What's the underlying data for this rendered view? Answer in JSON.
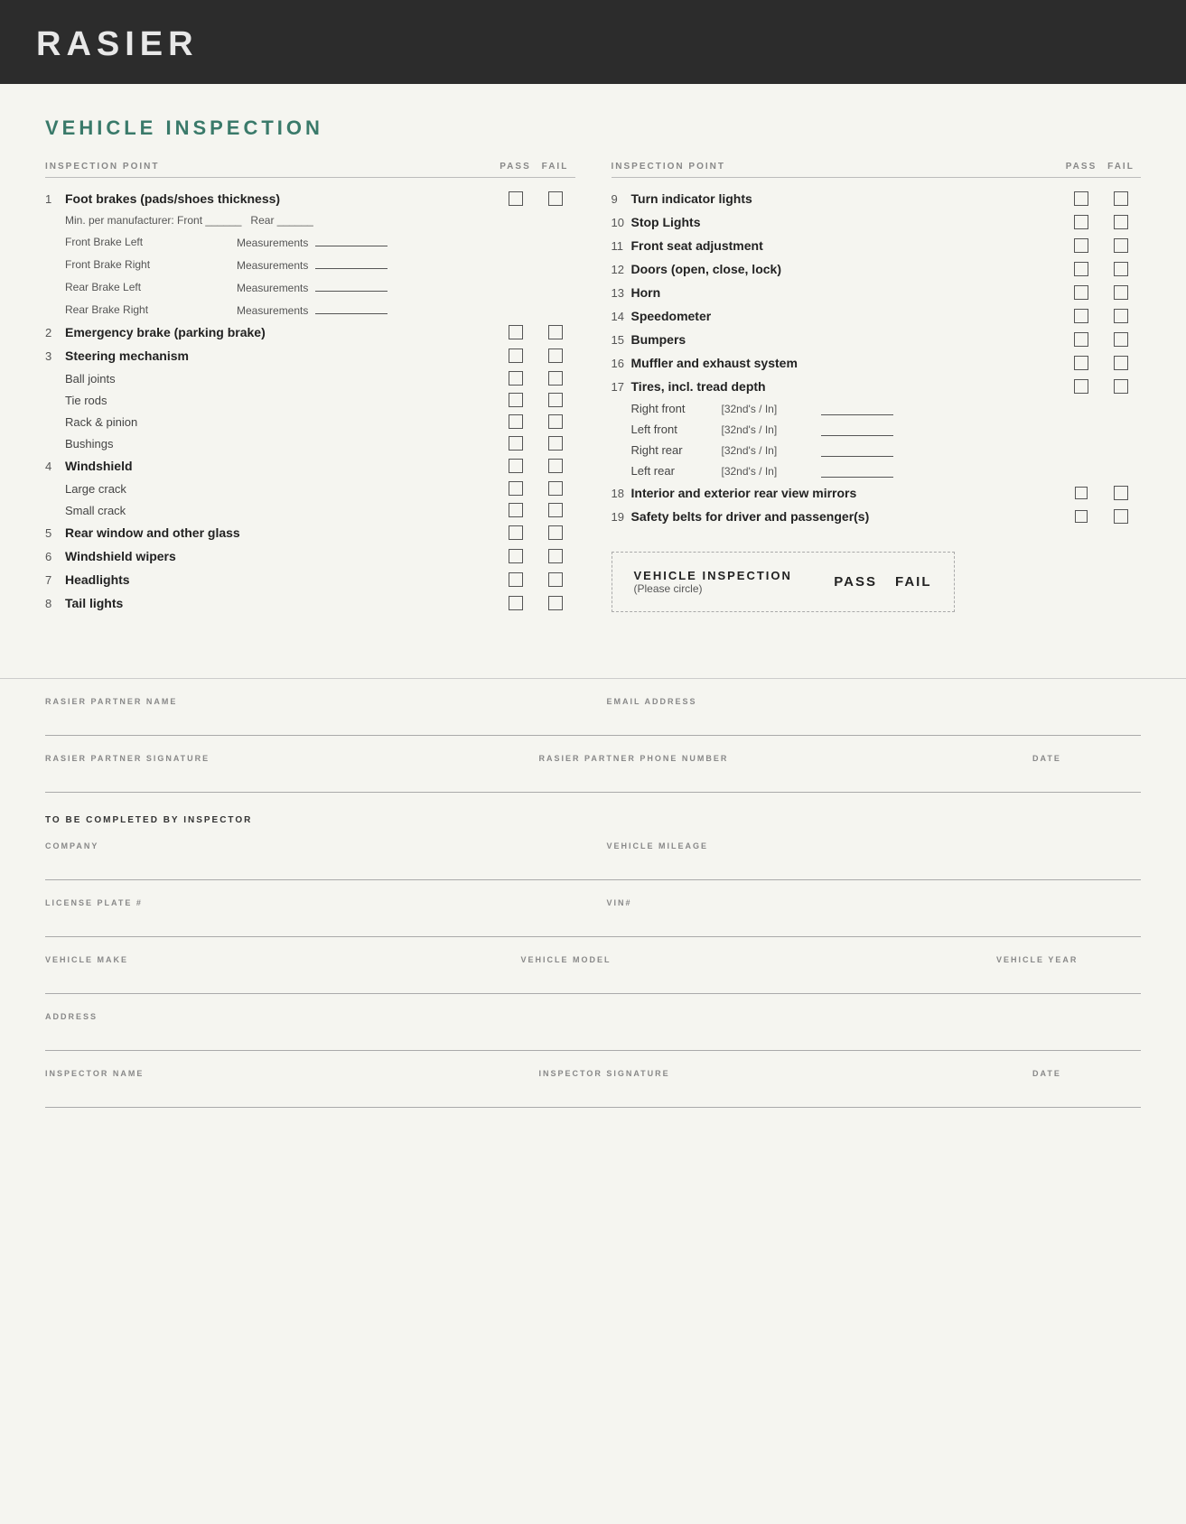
{
  "header": {
    "title": "RASIER"
  },
  "page": {
    "section_title": "VEHICLE INSPECTION",
    "col_headers": {
      "inspection_point": "INSPECTION POINT",
      "pass": "PASS",
      "fail": "FAIL"
    }
  },
  "left_items": [
    {
      "num": "1",
      "text": "Foot brakes (pads/shoes thickness)",
      "bold": true,
      "has_pass_fail": true,
      "sub_items": [
        {
          "type": "mfr",
          "text": "Min. per manufacturer:  Front ______   Rear ______"
        },
        {
          "type": "measurement",
          "label": "Front Brake Left",
          "sublabel": "Measurements"
        },
        {
          "type": "measurement",
          "label": "Front Brake Right",
          "sublabel": "Measurements"
        },
        {
          "type": "measurement",
          "label": "Rear Brake Left",
          "sublabel": "Measurements"
        },
        {
          "type": "measurement",
          "label": "Rear Brake Right",
          "sublabel": "Measurements"
        }
      ]
    },
    {
      "num": "2",
      "text": "Emergency brake (parking brake)",
      "bold": true,
      "has_pass_fail": true
    },
    {
      "num": "3",
      "text": "Steering mechanism",
      "bold": true,
      "has_pass_fail": true,
      "sub_items": [
        {
          "type": "checkbox",
          "text": "Ball joints"
        },
        {
          "type": "checkbox",
          "text": "Tie rods"
        },
        {
          "type": "checkbox",
          "text": "Rack & pinion"
        },
        {
          "type": "checkbox",
          "text": "Bushings"
        }
      ]
    },
    {
      "num": "4",
      "text": "Windshield",
      "bold": true,
      "has_pass_fail": true,
      "sub_items": [
        {
          "type": "checkbox",
          "text": "Large crack"
        },
        {
          "type": "checkbox",
          "text": "Small crack"
        }
      ]
    },
    {
      "num": "5",
      "text": "Rear window and other glass",
      "bold": true,
      "has_pass_fail": true
    },
    {
      "num": "6",
      "text": "Windshield wipers",
      "bold": true,
      "has_pass_fail": true
    },
    {
      "num": "7",
      "text": "Headlights",
      "bold": true,
      "has_pass_fail": true
    },
    {
      "num": "8",
      "text": "Tail lights",
      "bold": true,
      "has_pass_fail": true
    }
  ],
  "right_items": [
    {
      "num": "9",
      "text": "Turn indicator lights",
      "bold": true,
      "has_pass_fail": true
    },
    {
      "num": "10",
      "text": "Stop Lights",
      "bold": true,
      "has_pass_fail": true
    },
    {
      "num": "11",
      "text": "Front seat adjustment",
      "bold": true,
      "has_pass_fail": true
    },
    {
      "num": "12",
      "text": "Doors (open, close, lock)",
      "bold": true,
      "has_pass_fail": true
    },
    {
      "num": "13",
      "text": "Horn",
      "bold": true,
      "has_pass_fail": true
    },
    {
      "num": "14",
      "text": "Speedometer",
      "bold": true,
      "has_pass_fail": true
    },
    {
      "num": "15",
      "text": "Bumpers",
      "bold": true,
      "has_pass_fail": true
    },
    {
      "num": "16",
      "text": "Muffler and exhaust system",
      "bold": true,
      "has_pass_fail": true
    },
    {
      "num": "17",
      "text": "Tires, incl. tread depth",
      "bold": true,
      "has_pass_fail": true,
      "tires": [
        {
          "label": "Right front",
          "unit": "[32nd's / In]"
        },
        {
          "label": "Left front",
          "unit": "[32nd's / In]"
        },
        {
          "label": "Right rear",
          "unit": "[32nd's / In]"
        },
        {
          "label": "Left rear",
          "unit": "[32nd's / In]"
        }
      ]
    },
    {
      "num": "18",
      "text": "Interior and exterior rear view mirrors",
      "bold": true,
      "has_pass_fail": true
    },
    {
      "num": "19",
      "text": "Safety belts for driver and passenger(s)",
      "bold": true,
      "has_pass_fail": true
    }
  ],
  "summary_box": {
    "title": "VEHICLE INSPECTION",
    "subtitle": "(Please circle)",
    "pass_label": "PASS",
    "fail_label": "FAIL"
  },
  "form_fields": {
    "partner_name_label": "RASIER PARTNER NAME",
    "email_label": "EMAIL ADDRESS",
    "partner_signature_label": "RASIER PARTNER SIGNATURE",
    "partner_phone_label": "RASIER PARTNER PHONE NUMBER",
    "date_label": "DATE",
    "inspector_section_label": "TO BE COMPLETED BY INSPECTOR",
    "company_label": "COMPANY",
    "vehicle_mileage_label": "VEHICLE MILEAGE",
    "license_plate_label": "LICENSE PLATE #",
    "vin_label": "VIN#",
    "vehicle_make_label": "VEHICLE MAKE",
    "vehicle_model_label": "VEHICLE MODEL",
    "vehicle_year_label": "VEHICLE YEAR",
    "address_label": "ADDRESS",
    "inspector_name_label": "INSPECTOR NAME",
    "inspector_signature_label": "INSPECTOR SIGNATURE",
    "inspector_date_label": "DATE"
  }
}
